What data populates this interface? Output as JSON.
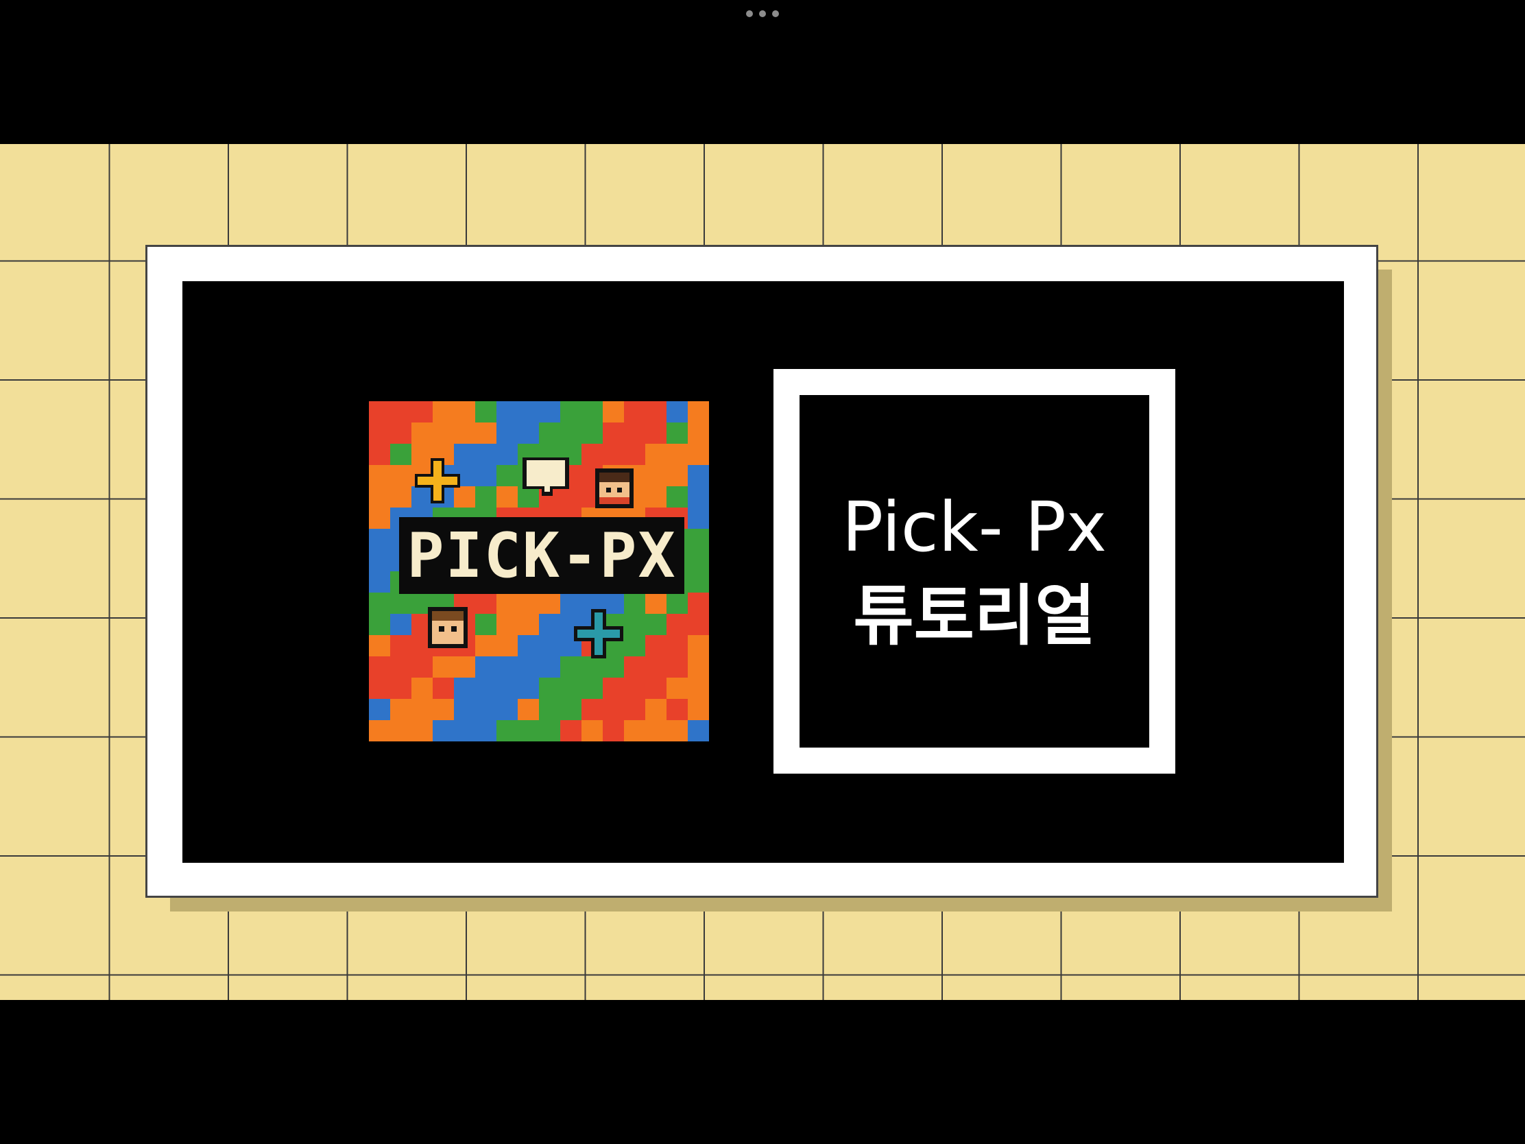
{
  "window": {
    "multitask_icon": "ellipsis-icon"
  },
  "logo": {
    "text": "PICK-PX",
    "icons": [
      "plus-icon",
      "speech-bubble-icon",
      "character-face-icon",
      "character-face-icon",
      "plus-icon"
    ]
  },
  "title_card": {
    "line1": "Pick- Px",
    "line2": "튜토리얼"
  },
  "colors": {
    "grid_background": "#f2df99",
    "grid_lines": "#3a3a3a",
    "frame": "#ffffff",
    "stage": "#000000",
    "logo_red": "#e8412a",
    "logo_orange": "#f57c1f",
    "logo_blue": "#2f74c9",
    "logo_green": "#3aa13a"
  }
}
